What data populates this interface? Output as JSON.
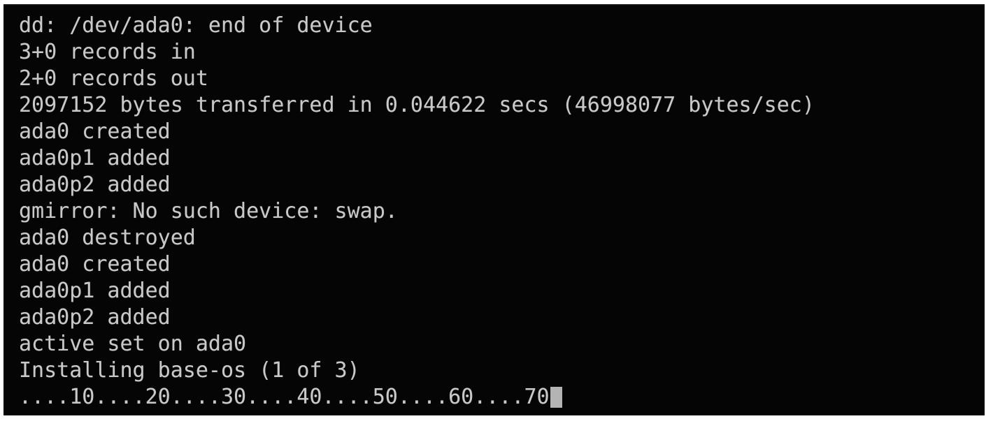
{
  "terminal": {
    "background_color": "#050505",
    "text_color": "#c9c9c9",
    "cursor_color": "#b4b4b4",
    "lines": [
      "dd: /dev/ada0: end of device",
      "3+0 records in",
      "2+0 records out",
      "2097152 bytes transferred in 0.044622 secs (46998077 bytes/sec)",
      "ada0 created",
      "ada0p1 added",
      "ada0p2 added",
      "gmirror: No such device: swap.",
      "ada0 destroyed",
      "ada0 created",
      "ada0p1 added",
      "ada0p2 added",
      "active set on ada0",
      "Installing base-os (1 of 3)"
    ],
    "progress_line": "....10....20....30....40....50....60....70",
    "cursor": "block-cursor"
  }
}
